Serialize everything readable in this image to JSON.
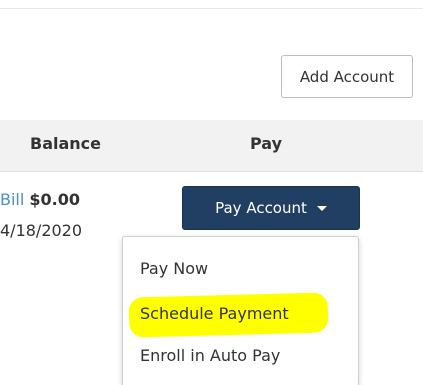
{
  "toolbar": {
    "add_account_label": "Add Account"
  },
  "table": {
    "columns": {
      "balance": "Balance",
      "pay": "Pay"
    },
    "row": {
      "bill_prefix": "Bill",
      "balance": "$0.00",
      "date": "4/18/2020"
    }
  },
  "pay_menu": {
    "button_label": "Pay Account",
    "button_icon": "chevron-down-icon",
    "items": [
      {
        "label": "Pay Now"
      },
      {
        "label": "Schedule Payment"
      },
      {
        "label": "Enroll in Auto Pay"
      }
    ]
  },
  "colors": {
    "primary_button": "#213f63",
    "link": "#4a90c8",
    "highlight": "#ffff00"
  }
}
